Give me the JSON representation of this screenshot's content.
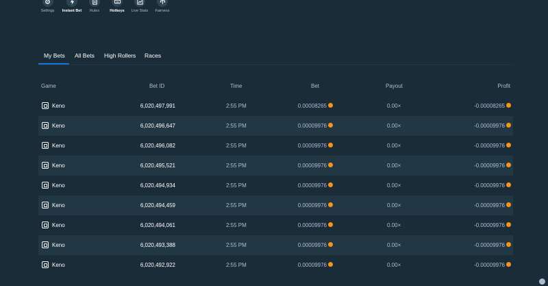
{
  "toolbar": [
    {
      "icon": "gear-icon",
      "label": "Settings",
      "bold": false
    },
    {
      "icon": "lightning-icon",
      "label": "Instant Bet",
      "bold": true
    },
    {
      "icon": "rules-icon",
      "label": "Rules",
      "bold": false
    },
    {
      "icon": "keyboard-icon",
      "label": "Hotkeys",
      "bold": true
    },
    {
      "icon": "stats-icon",
      "label": "Live Stats",
      "bold": false
    },
    {
      "icon": "fairness-icon",
      "label": "Fairness",
      "bold": false
    }
  ],
  "tabs": {
    "my_bets": "My Bets",
    "all_bets": "All Bets",
    "high_rollers": "High Rollers",
    "races": "Races"
  },
  "columns": {
    "game": "Game",
    "bet_id": "Bet ID",
    "time": "Time",
    "bet": "Bet",
    "payout": "Payout",
    "profit": "Profit"
  },
  "coin_color": "#f7931a",
  "rows": [
    {
      "game": "Keno",
      "bet_id": "6,020,497,991",
      "time": "2:55 PM",
      "bet": "0.00008265",
      "payout": "0.00×",
      "profit": "-0.00008265"
    },
    {
      "game": "Keno",
      "bet_id": "6,020,496,647",
      "time": "2:55 PM",
      "bet": "0.00009976",
      "payout": "0.00×",
      "profit": "-0.00009976"
    },
    {
      "game": "Keno",
      "bet_id": "6,020,496,082",
      "time": "2:55 PM",
      "bet": "0.00009976",
      "payout": "0.00×",
      "profit": "-0.00009976"
    },
    {
      "game": "Keno",
      "bet_id": "6,020,495,521",
      "time": "2:55 PM",
      "bet": "0.00009976",
      "payout": "0.00×",
      "profit": "-0.00009976"
    },
    {
      "game": "Keno",
      "bet_id": "6,020,494,934",
      "time": "2:55 PM",
      "bet": "0.00009976",
      "payout": "0.00×",
      "profit": "-0.00009976"
    },
    {
      "game": "Keno",
      "bet_id": "6,020,494,459",
      "time": "2:55 PM",
      "bet": "0.00009976",
      "payout": "0.00×",
      "profit": "-0.00009976"
    },
    {
      "game": "Keno",
      "bet_id": "6,020,494,061",
      "time": "2:55 PM",
      "bet": "0.00009976",
      "payout": "0.00×",
      "profit": "-0.00009976"
    },
    {
      "game": "Keno",
      "bet_id": "6,020,493,388",
      "time": "2:55 PM",
      "bet": "0.00009976",
      "payout": "0.00×",
      "profit": "-0.00009976"
    },
    {
      "game": "Keno",
      "bet_id": "6,020,492,922",
      "time": "2:55 PM",
      "bet": "0.00009976",
      "payout": "0.00×",
      "profit": "-0.00009976"
    }
  ]
}
